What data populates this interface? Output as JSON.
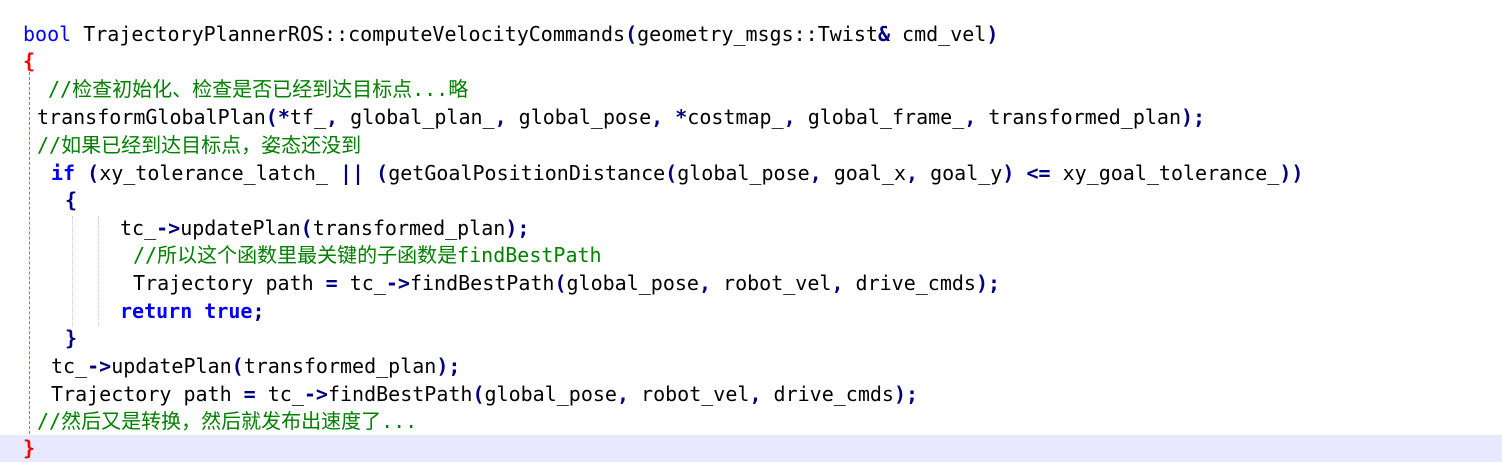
{
  "editor": {
    "lines": [
      {
        "id": "l1",
        "parts": [
          {
            "t": "bool",
            "c": "kw-plain"
          },
          {
            "t": " TrajectoryPlannerROS::computeVelocityCommands"
          },
          {
            "t": "(",
            "c": "op"
          },
          {
            "t": "geometry_msgs::Twist"
          },
          {
            "t": "&",
            "c": "op"
          },
          {
            "t": " cmd_vel"
          },
          {
            "t": ")",
            "c": "op"
          }
        ]
      },
      {
        "id": "l2",
        "parts": [
          {
            "t": "{",
            "c": "brace-red"
          }
        ]
      },
      {
        "id": "l3",
        "parts": [
          {
            "t": "//检查初始化、检查是否已经到达目标点...略",
            "c": "comment"
          }
        ]
      },
      {
        "id": "l4",
        "parts": [
          {
            "t": "transformGlobalPlan"
          },
          {
            "t": "(*",
            "c": "op"
          },
          {
            "t": "tf_"
          },
          {
            "t": ",",
            "c": "op"
          },
          {
            "t": " global_plan_"
          },
          {
            "t": ",",
            "c": "op"
          },
          {
            "t": " global_pose"
          },
          {
            "t": ",",
            "c": "op"
          },
          {
            "t": " "
          },
          {
            "t": "*",
            "c": "op"
          },
          {
            "t": "costmap_"
          },
          {
            "t": ",",
            "c": "op"
          },
          {
            "t": " global_frame_"
          },
          {
            "t": ",",
            "c": "op"
          },
          {
            "t": " transformed_plan"
          },
          {
            "t": ");",
            "c": "op"
          }
        ]
      },
      {
        "id": "l5",
        "parts": [
          {
            "t": "//如果已经到达目标点，姿态还没到",
            "c": "comment"
          }
        ]
      },
      {
        "id": "l6",
        "parts": [
          {
            "t": "if",
            "c": "kw"
          },
          {
            "t": " "
          },
          {
            "t": "(",
            "c": "op"
          },
          {
            "t": "xy_tolerance_latch_ "
          },
          {
            "t": "||",
            "c": "op"
          },
          {
            "t": " "
          },
          {
            "t": "(",
            "c": "op"
          },
          {
            "t": "getGoalPositionDistance"
          },
          {
            "t": "(",
            "c": "op"
          },
          {
            "t": "global_pose"
          },
          {
            "t": ",",
            "c": "op"
          },
          {
            "t": " goal_x"
          },
          {
            "t": ",",
            "c": "op"
          },
          {
            "t": " goal_y"
          },
          {
            "t": ")",
            "c": "op"
          },
          {
            "t": " "
          },
          {
            "t": "<=",
            "c": "op"
          },
          {
            "t": " xy_goal_tolerance_"
          },
          {
            "t": "))",
            "c": "op"
          }
        ]
      },
      {
        "id": "l7",
        "parts": [
          {
            "t": "{",
            "c": "brace-blue"
          }
        ]
      },
      {
        "id": "l8",
        "parts": [
          {
            "t": "tc_"
          },
          {
            "t": "->",
            "c": "op"
          },
          {
            "t": "updatePlan"
          },
          {
            "t": "(",
            "c": "op"
          },
          {
            "t": "transformed_plan"
          },
          {
            "t": ");",
            "c": "op"
          }
        ]
      },
      {
        "id": "l9",
        "parts": [
          {
            "t": "//所以这个函数里最关键的子函数是findBestPath",
            "c": "comment"
          }
        ]
      },
      {
        "id": "l10",
        "parts": [
          {
            "t": "Trajectory path "
          },
          {
            "t": "=",
            "c": "op"
          },
          {
            "t": " tc_"
          },
          {
            "t": "->",
            "c": "op"
          },
          {
            "t": "findBestPath"
          },
          {
            "t": "(",
            "c": "op"
          },
          {
            "t": "global_pose"
          },
          {
            "t": ",",
            "c": "op"
          },
          {
            "t": " robot_vel"
          },
          {
            "t": ",",
            "c": "op"
          },
          {
            "t": " drive_cmds"
          },
          {
            "t": ");",
            "c": "op"
          }
        ]
      },
      {
        "id": "l11",
        "parts": [
          {
            "t": "return",
            "c": "kw"
          },
          {
            "t": " "
          },
          {
            "t": "true",
            "c": "kw"
          },
          {
            "t": ";",
            "c": "op"
          }
        ]
      },
      {
        "id": "l12",
        "parts": [
          {
            "t": "}",
            "c": "brace-blue"
          }
        ]
      },
      {
        "id": "l13",
        "parts": [
          {
            "t": "tc_"
          },
          {
            "t": "->",
            "c": "op"
          },
          {
            "t": "updatePlan"
          },
          {
            "t": "(",
            "c": "op"
          },
          {
            "t": "transformed_plan"
          },
          {
            "t": ");",
            "c": "op"
          }
        ]
      },
      {
        "id": "l14",
        "parts": [
          {
            "t": "Trajectory path "
          },
          {
            "t": "=",
            "c": "op"
          },
          {
            "t": " tc_"
          },
          {
            "t": "->",
            "c": "op"
          },
          {
            "t": "findBestPath"
          },
          {
            "t": "(",
            "c": "op"
          },
          {
            "t": "global_pose"
          },
          {
            "t": ",",
            "c": "op"
          },
          {
            "t": " robot_vel"
          },
          {
            "t": ",",
            "c": "op"
          },
          {
            "t": " drive_cmds"
          },
          {
            "t": ");",
            "c": "op"
          }
        ]
      },
      {
        "id": "l15",
        "parts": [
          {
            "t": "//然后又是转换，然后就发布出速度了...",
            "c": "comment"
          }
        ]
      },
      {
        "id": "l16",
        "parts": [
          {
            "t": "}",
            "c": "brace-red"
          }
        ],
        "current": true
      }
    ]
  },
  "colors": {
    "keyword": "#0000ff",
    "comment": "#008000",
    "operator": "#000080",
    "fold_brace": "#ff0000",
    "current_line": "#e8e8ff"
  }
}
